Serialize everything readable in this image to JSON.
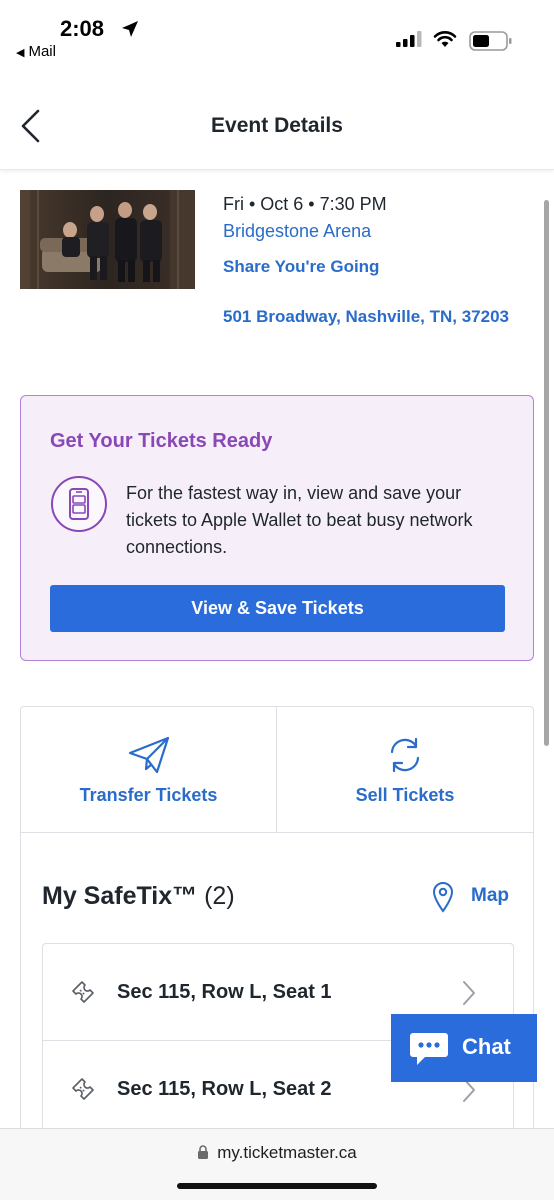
{
  "status_bar": {
    "time": "2:08",
    "back_app": "Mail"
  },
  "nav": {
    "title": "Event Details"
  },
  "event": {
    "date": "Fri • Oct 6 • 7:30 PM",
    "venue": "Bridgestone Arena",
    "share": "Share You're Going",
    "address": "501 Broadway, Nashville, TN, 37203"
  },
  "promo": {
    "title": "Get Your Tickets Ready",
    "text": "For the fastest way in, view and save your tickets to Apple Wallet to beat busy network connections.",
    "button": "View & Save Tickets"
  },
  "actions": {
    "transfer": "Transfer Tickets",
    "sell": "Sell Tickets"
  },
  "safetix": {
    "title": "My SafeTix™",
    "count": "(2)",
    "map_label": "Map",
    "seats": [
      {
        "label": "Sec 115, Row L, Seat 1"
      },
      {
        "label": "Sec 115, Row L, Seat 2"
      }
    ]
  },
  "chat": {
    "label": "Chat"
  },
  "browser": {
    "url": "my.ticketmaster.ca"
  },
  "colors": {
    "link_blue": "#2a6cc9",
    "button_blue": "#2a6cdb",
    "promo_purple": "#8a48b6",
    "promo_bg": "#f6effa"
  }
}
